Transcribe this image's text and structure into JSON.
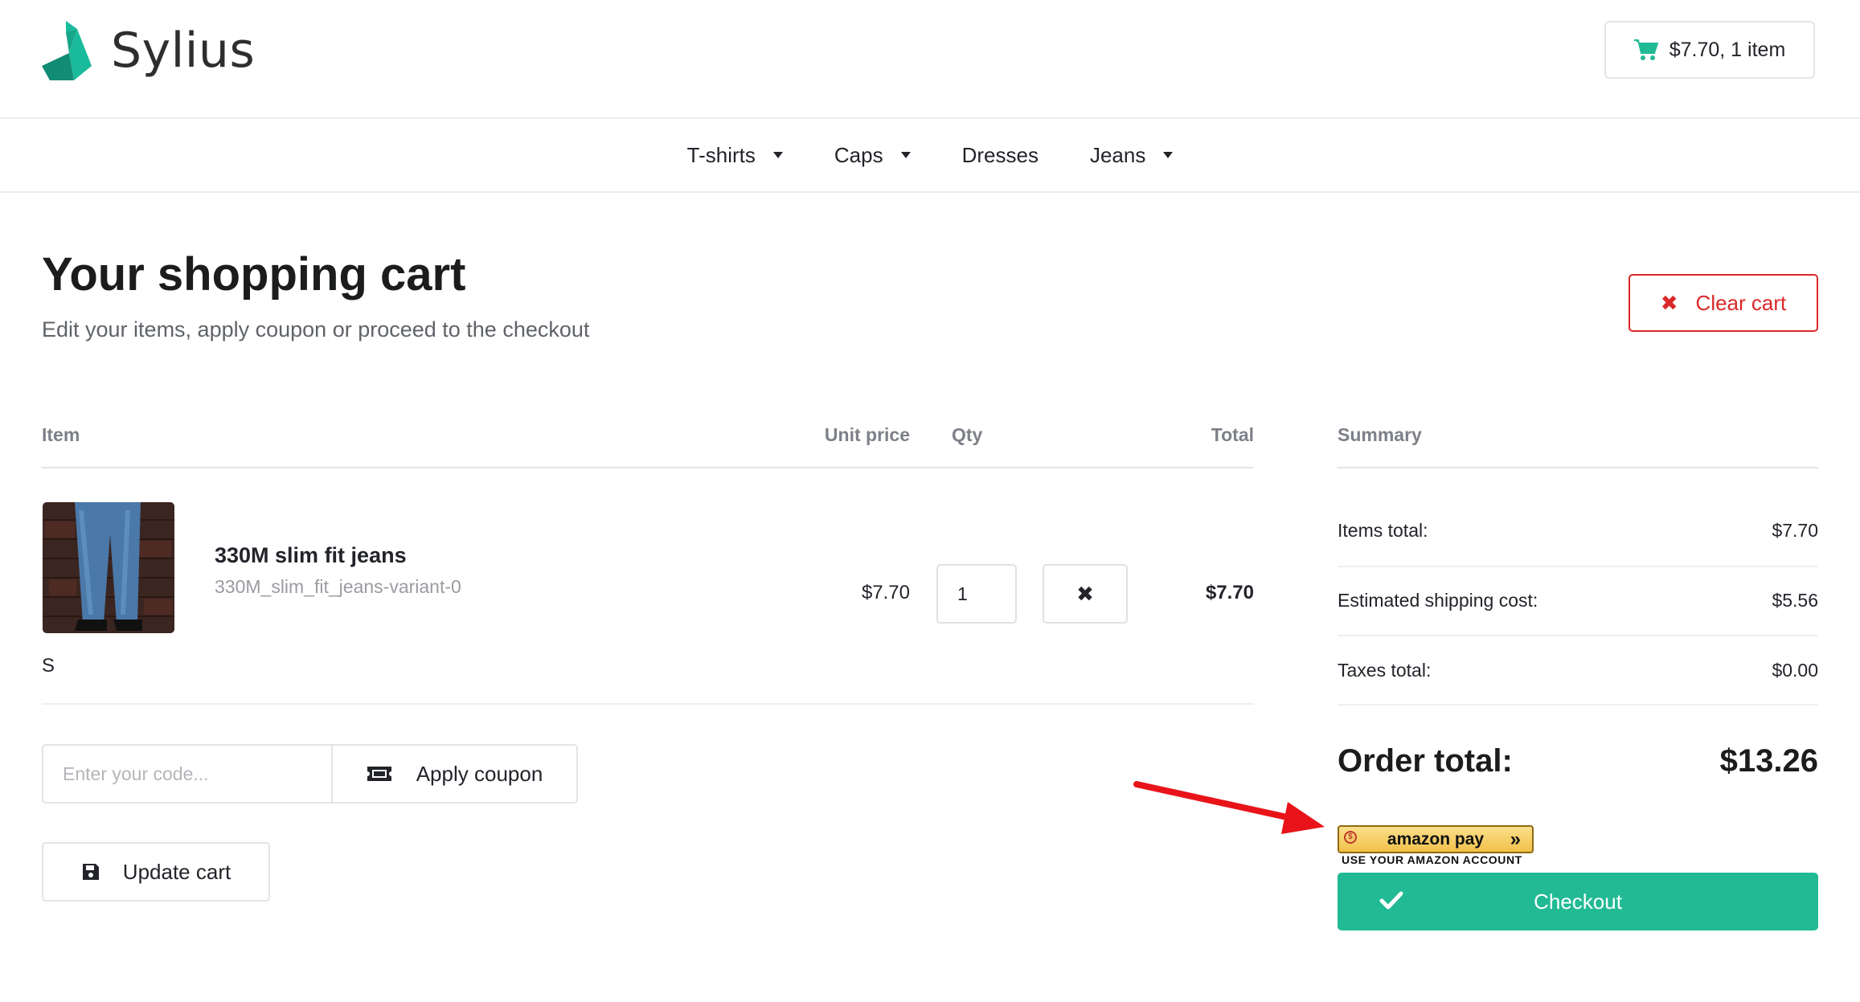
{
  "brand": {
    "name": "Sylius",
    "logo_icon": "swan-logo-icon",
    "accent": "#21ba95"
  },
  "header": {
    "cart_summary": "$7.70, 1 item",
    "cart_icon": "shopping-cart-icon"
  },
  "nav": {
    "items": [
      {
        "label": "T-shirts",
        "has_dropdown": true
      },
      {
        "label": "Caps",
        "has_dropdown": true
      },
      {
        "label": "Dresses",
        "has_dropdown": false
      },
      {
        "label": "Jeans",
        "has_dropdown": true
      }
    ]
  },
  "page": {
    "title": "Your shopping cart",
    "subtitle": "Edit your items, apply coupon or proceed to the checkout",
    "clear_cart_label": "Clear cart",
    "clear_color": "#db2828"
  },
  "table": {
    "headers": {
      "item": "Item",
      "unit_price": "Unit price",
      "qty": "Qty",
      "total": "Total"
    },
    "rows": [
      {
        "name": "330M slim fit jeans",
        "variant": "330M_slim_fit_jeans-variant-0",
        "option": "S",
        "unit_price": "$7.70",
        "qty": "1",
        "total": "$7.70"
      }
    ]
  },
  "coupon": {
    "placeholder": "Enter your code...",
    "apply_label": "Apply coupon"
  },
  "update_label": "Update cart",
  "summary": {
    "heading": "Summary",
    "rows": [
      {
        "label": "Items total:",
        "value": "$7.70"
      },
      {
        "label": "Estimated shipping cost:",
        "value": "$5.56"
      },
      {
        "label": "Taxes total:",
        "value": "$0.00"
      }
    ],
    "order_total_label": "Order total:",
    "order_total_value": "$13.26"
  },
  "amazon_pay": {
    "logo_text": "amazon pay",
    "chevron": "»",
    "subtext": "USE YOUR AMAZON ACCOUNT"
  },
  "checkout_label": "Checkout"
}
